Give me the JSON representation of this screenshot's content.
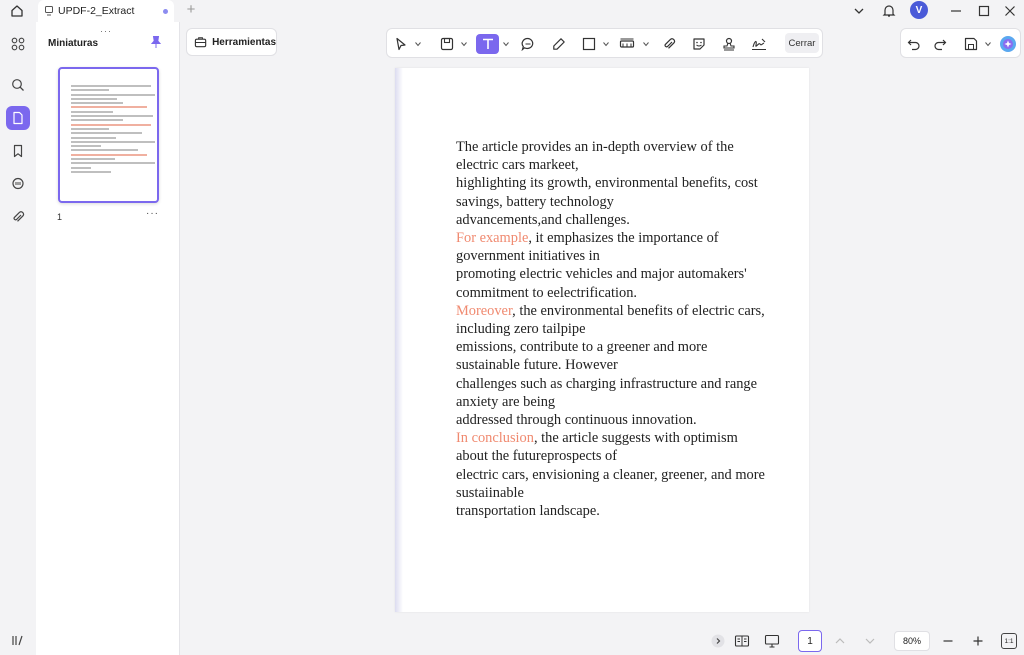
{
  "app": {
    "tab_title": "UPDF-2_Extract",
    "avatar_initial": "V",
    "accent_color": "#7b68ee"
  },
  "sidebar": {
    "panel_title": "Miniaturas",
    "thumbnail_page_number": "1"
  },
  "toolbar": {
    "tools_label": "Herramientas",
    "close_label": "Cerrar"
  },
  "document": {
    "lines": [
      {
        "text": "The article provides an in-depth overview of the"
      },
      {
        "text": "electric cars markeet,"
      },
      {
        "text": "highlighting its growth, environmental benefits, cost"
      },
      {
        "text": "savings, battery technology"
      },
      {
        "text": "advancements,and challenges."
      },
      {
        "hl": "For example",
        "text": ", it emphasizes the importance of"
      },
      {
        "text": "government initiatives in"
      },
      {
        "text": "promoting electric vehicles and major automakers'"
      },
      {
        "text": "commitment to eelectrification."
      },
      {
        "hl": "Moreover",
        "text": ", the environmental benefits of electric cars,"
      },
      {
        "text": "including zero tailpipe"
      },
      {
        "text": "emissions, contribute to a greener and more"
      },
      {
        "text": "sustainable future. However"
      },
      {
        "text": "challenges such as charging infrastructure and range"
      },
      {
        "text": "anxiety are being"
      },
      {
        "text": "addressed through continuous innovation."
      },
      {
        "hl": "In conclusion",
        "text": ", the article suggests with optimism"
      },
      {
        "text": "about the futureprospects of"
      },
      {
        "text": "electric cars, envisioning a cleaner, greener, and more"
      },
      {
        "text": "sustaiinable"
      },
      {
        "text": "transportation landscape."
      }
    ]
  },
  "statusbar": {
    "current_page": "1",
    "zoom": "80%",
    "fit_label": "1:1"
  }
}
